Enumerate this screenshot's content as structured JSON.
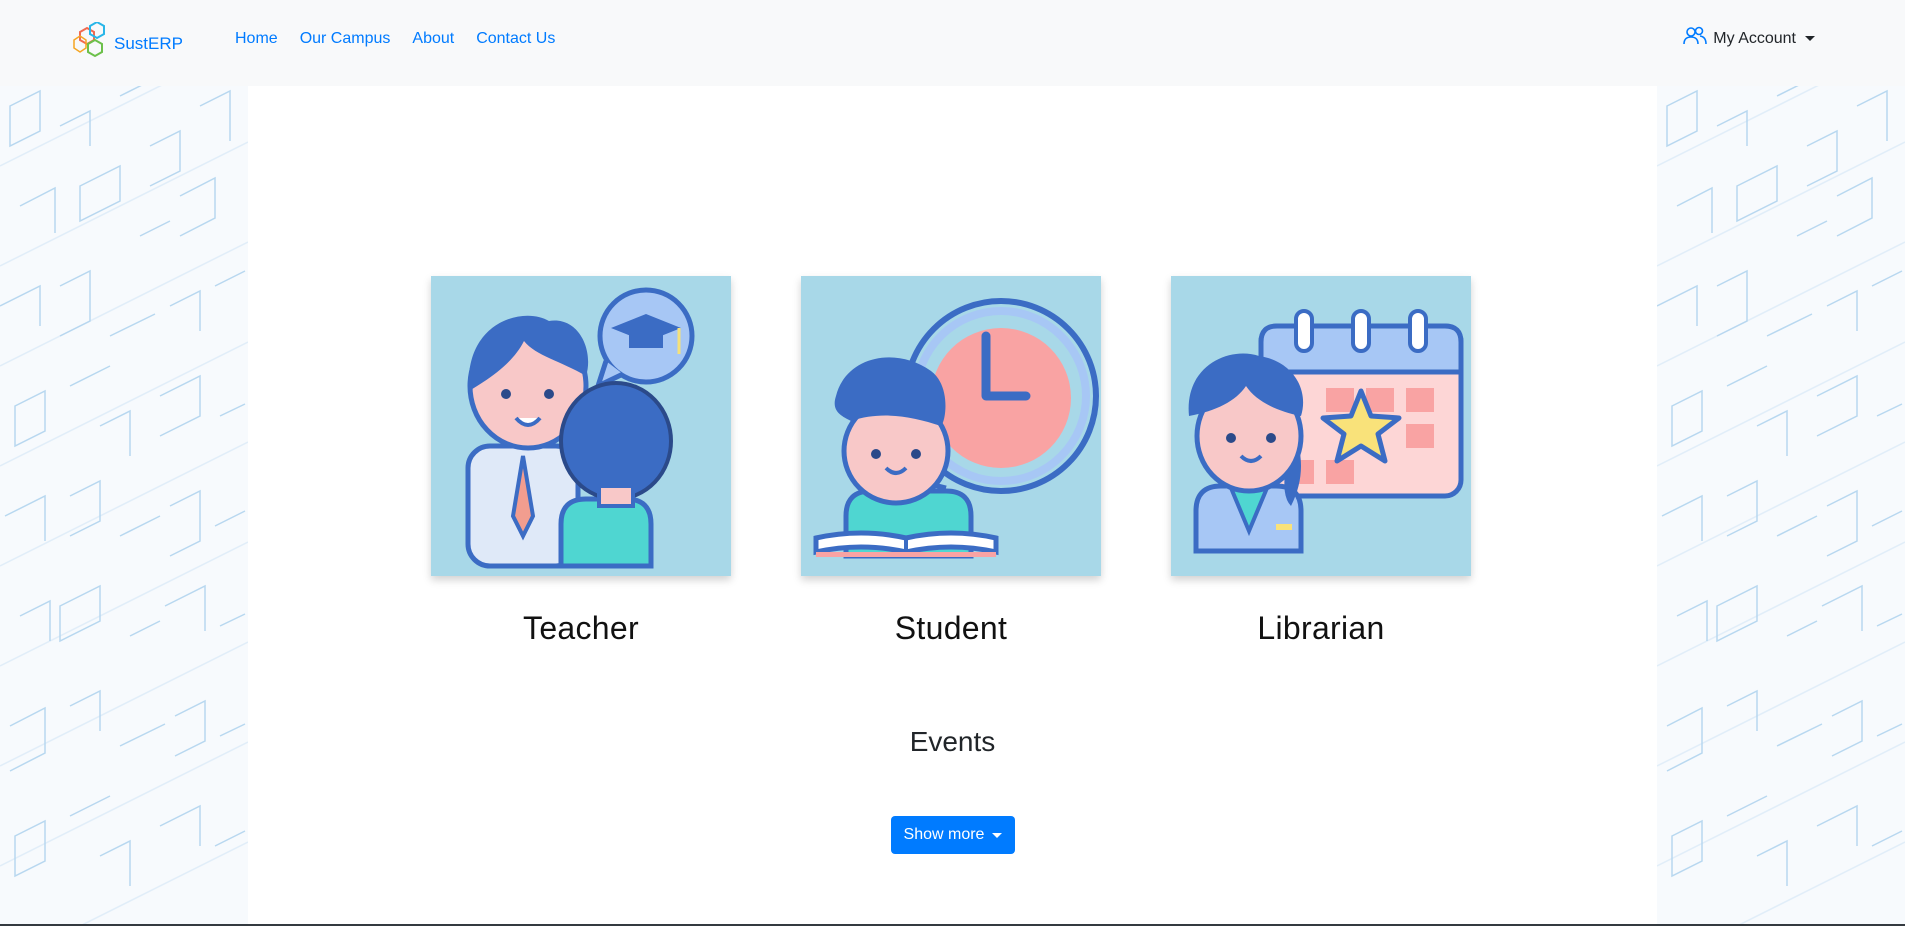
{
  "brand": {
    "name": "SustERP",
    "logo_icon": "hexagon-logo-icon"
  },
  "nav": {
    "links": [
      {
        "label": "Home"
      },
      {
        "label": "Our Campus"
      },
      {
        "label": "About"
      },
      {
        "label": "Contact Us"
      }
    ],
    "account": {
      "label": "My Account",
      "icon": "users-icon"
    }
  },
  "roles": [
    {
      "label": "Teacher",
      "icon": "teacher-illustration"
    },
    {
      "label": "Student",
      "icon": "student-illustration"
    },
    {
      "label": "Librarian",
      "icon": "librarian-illustration"
    }
  ],
  "events": {
    "title": "Events",
    "button_label": "Show more"
  },
  "colors": {
    "primary": "#007bff",
    "card_bg": "#a8d8e8",
    "illustration_blue": "#3b6cc4",
    "skin": "#f8c8c8",
    "pattern_line": "#b8d8f0"
  }
}
